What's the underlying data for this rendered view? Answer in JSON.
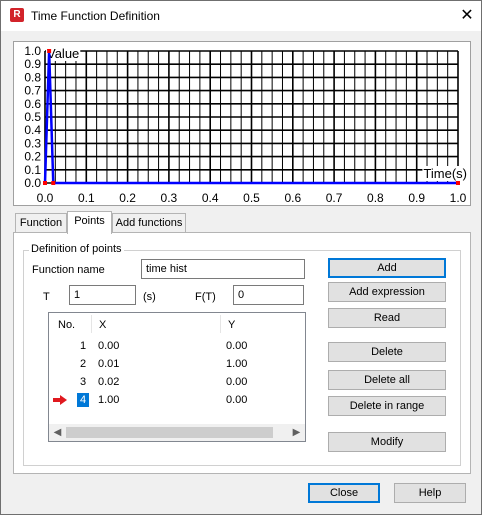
{
  "window": {
    "title": "Time Function Definition",
    "app_icon": "R",
    "close_glyph": "✕"
  },
  "chart_data": {
    "type": "line",
    "ylabel": "Value",
    "xlabel": "Time(s)",
    "xlim": [
      0,
      1
    ],
    "ylim": [
      0,
      1
    ],
    "x_ticks": [
      "0.0",
      "0.1",
      "0.2",
      "0.3",
      "0.4",
      "0.5",
      "0.6",
      "0.7",
      "0.8",
      "0.9",
      "1.0"
    ],
    "y_ticks": [
      "0.0",
      "0.1",
      "0.2",
      "0.3",
      "0.4",
      "0.5",
      "0.6",
      "0.7",
      "0.8",
      "0.9",
      "1.0"
    ],
    "grid": true,
    "series": [
      {
        "x": [
          0.0,
          0.01,
          0.02,
          1.0
        ],
        "y": [
          0.0,
          1.0,
          0.0,
          0.0
        ],
        "color": "#0000ff"
      }
    ]
  },
  "tabs": [
    {
      "label": "Function"
    },
    {
      "label": "Points"
    },
    {
      "label": "Add functions"
    }
  ],
  "points": {
    "group_title": "Definition of points",
    "function_name_label": "Function name",
    "function_name_value": "time hist",
    "t_label": "T",
    "t_value": "1",
    "t_unit": "(s)",
    "ft_label": "F(T)",
    "ft_value": "0",
    "columns": [
      "No.",
      "X",
      "Y"
    ],
    "rows": [
      {
        "no": "1",
        "x": "0.00",
        "y": "0.00"
      },
      {
        "no": "2",
        "x": "0.01",
        "y": "1.00"
      },
      {
        "no": "3",
        "x": "0.02",
        "y": "0.00"
      },
      {
        "no": "4",
        "x": "1.00",
        "y": "0.00"
      }
    ],
    "buttons": {
      "add": "Add",
      "add_expression": "Add expression",
      "read": "Read",
      "delete": "Delete",
      "delete_all": "Delete all",
      "delete_in_range": "Delete in range",
      "modify": "Modify"
    }
  },
  "footer": {
    "close": "Close",
    "help": "Help"
  },
  "colors": {
    "series": "#0000ff",
    "marker": "#ff0000",
    "selection": "#0078d7",
    "arrow": "#e0191f"
  }
}
